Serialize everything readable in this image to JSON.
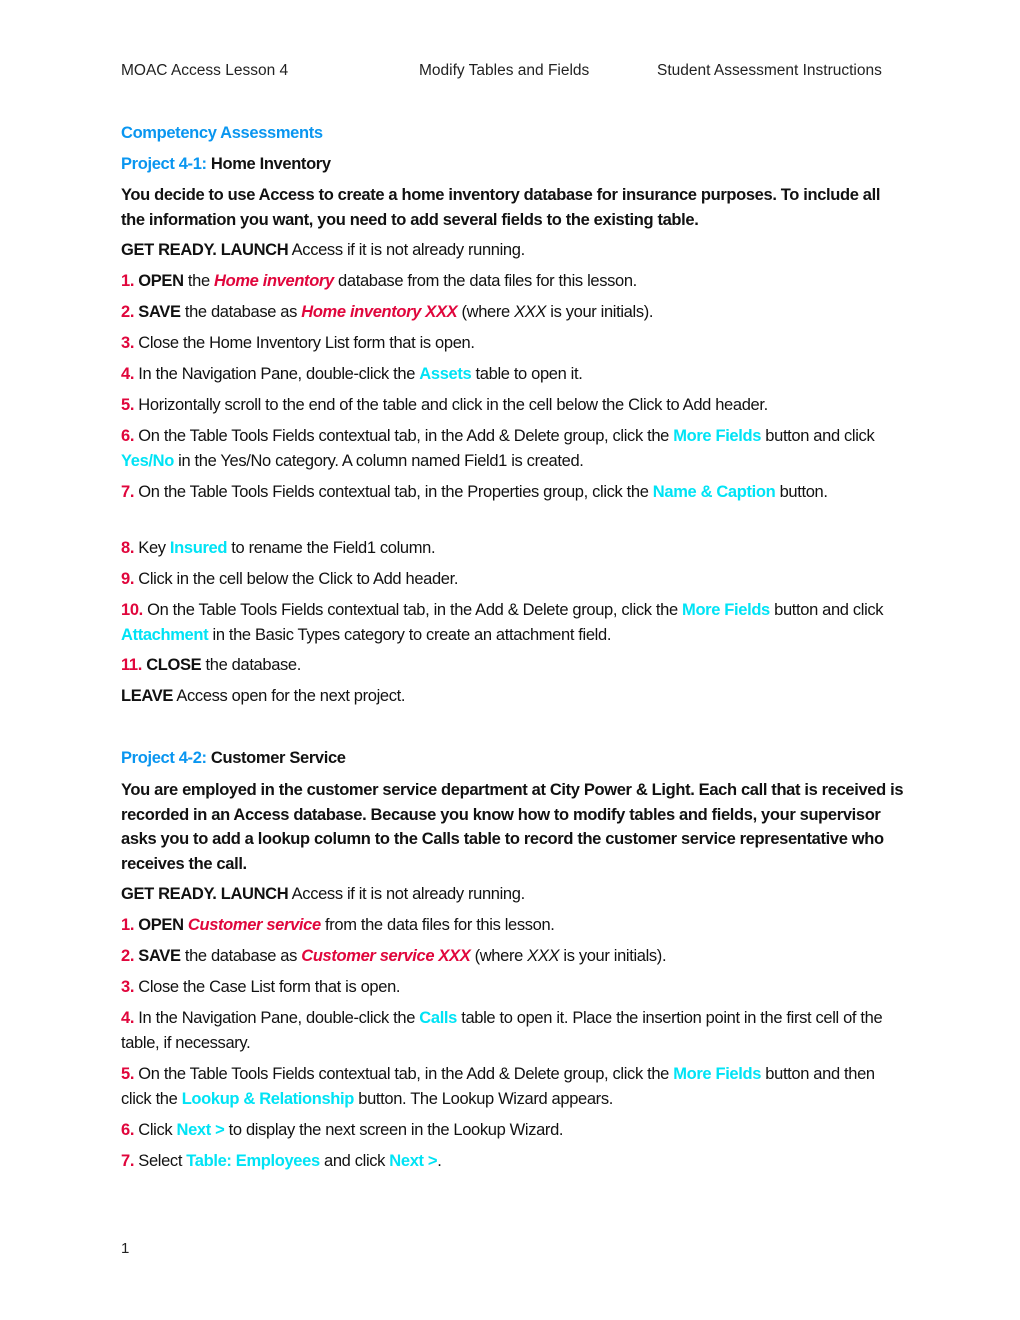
{
  "header": {
    "left": "MOAC Access Lesson 4",
    "center": "Modify Tables and Fields",
    "right": "Student Assessment Instructions"
  },
  "section_title": "Competency Assessments",
  "colors": {
    "heading_blue": "#0A96F0",
    "step_red": "#E0063C",
    "ui_cyan": "#00E3F5"
  },
  "project1": {
    "label": "Project 4-1:",
    "title": "Home Inventory",
    "intro": "You decide to use Access to create a home inventory database for insurance purposes. To include all the information you want, you need to add several fields to the existing table.",
    "get_ready": "GET READY. LAUNCH",
    "get_ready_rest": " Access if it is not already running.",
    "steps": {
      "s1": {
        "num": "1.",
        "a": "OPEN",
        "b": " the ",
        "c": "Home inventory",
        "d": " database from the data files for this lesson."
      },
      "s2": {
        "num": "2.",
        "a": "SAVE",
        "b": " the database as ",
        "c": "Home inventory XXX",
        "d": " (where ",
        "e": "XXX",
        "f": " is your initials)."
      },
      "s3": {
        "num": "3.",
        "text": " Close the Home Inventory List form that is open."
      },
      "s4": {
        "num": "4.",
        "a": " In the Navigation Pane, double-click the ",
        "b": "Assets",
        "c": " table to open it."
      },
      "s5": {
        "num": "5.",
        "text": " Horizontally scroll to the end of the table and click in the cell below the Click to Add header."
      },
      "s6": {
        "num": "6.",
        "a": " On the Table Tools Fields contextual tab, in the Add & Delete group, click the ",
        "b": "More Fields",
        "c": " button and click ",
        "d": "Yes/No",
        "e": " in the Yes/No category. A column named Field1 is created."
      },
      "s7": {
        "num": "7.",
        "a": " On the Table Tools Fields contextual tab, in the Properties group, click the ",
        "b": "Name & Caption",
        "c": " button."
      },
      "s8": {
        "num": "8.",
        "a": " Key ",
        "b": "Insured",
        "c": " to rename the Field1 column."
      },
      "s9": {
        "num": "9.",
        "text": " Click in the cell below the Click to Add header."
      },
      "s10": {
        "num": "10.",
        "a": " On the Table Tools Fields contextual tab, in the Add & Delete group, click the ",
        "b": "More Fields",
        "c": " button and click ",
        "d": "Attachment",
        "e": " in the Basic Types category to create an attachment field."
      },
      "s11": {
        "num": "11.",
        "a": " CLOSE",
        "b": " the database."
      }
    },
    "leave": "LEAVE",
    "leave_rest": " Access open for the next project."
  },
  "project2": {
    "label": "Project 4-2:",
    "title": "Customer Service",
    "intro": "You are employed in the customer service department at City Power & Light. Each call that is received is recorded in an Access database. Because you know how to modify tables and fields, your supervisor asks you to add a lookup column to the Calls table to record the customer service representative who receives the call.",
    "get_ready": "GET READY. LAUNCH",
    "get_ready_rest": " Access if it is not already running.",
    "steps": {
      "s1": {
        "num": "1.",
        "a": " OPEN",
        "b": " ",
        "c": "Customer service",
        "d": " from the data files for this lesson."
      },
      "s2": {
        "num": "2.",
        "a": " SAVE",
        "b": " the database as ",
        "c": "Customer service XXX",
        "d": " (where ",
        "e": "XXX",
        "f": " is your initials)."
      },
      "s3": {
        "num": "3.",
        "text": " Close the Case List form that is open."
      },
      "s4": {
        "num": "4.",
        "a": " In the Navigation Pane, double-click the ",
        "b": "Calls",
        "c": " table to open it. Place the insertion point in the first cell of the table, if necessary."
      },
      "s5": {
        "num": "5.",
        "a": " On the Table Tools Fields contextual tab, in the Add & Delete group, click the ",
        "b": "More Fields",
        "c": " button and then click the ",
        "d": "Lookup & Relationship",
        "e": " button. The Lookup Wizard appears."
      },
      "s6": {
        "num": "6.",
        "a": " Click ",
        "b": "Next >",
        "c": " to display the next screen in the Lookup Wizard."
      },
      "s7": {
        "num": "7.",
        "a": " Select ",
        "b": "Table: Employees",
        "c": " and click ",
        "d": "Next >",
        "e": "."
      }
    }
  },
  "page_number": "1"
}
